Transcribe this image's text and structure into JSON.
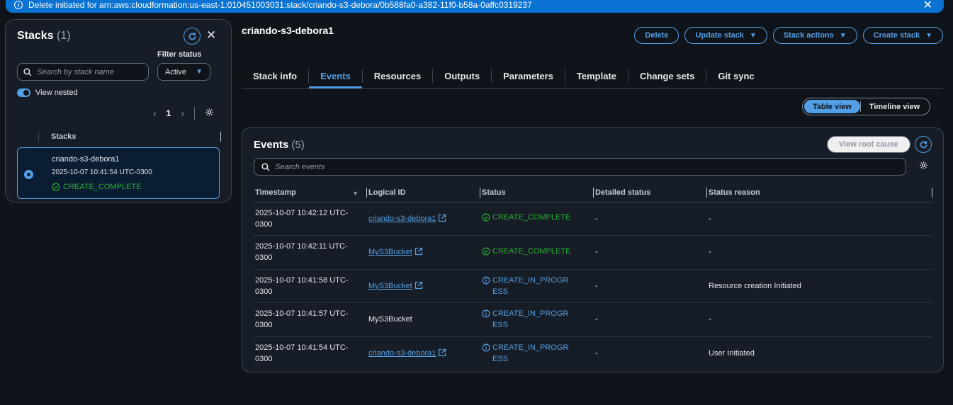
{
  "flash": {
    "message": "Delete initiated for arn:aws:cloudformation:us-east-1:010451003031:stack/criando-s3-debora/0b588fa0-a382-11f0-b58a-0affc0319237"
  },
  "stacks_panel": {
    "title": "Stacks",
    "count": "(1)",
    "filter_label": "Filter status",
    "search_placeholder": "Search by stack name",
    "filter_value": "Active",
    "view_nested_label": "View nested",
    "page": "1",
    "column_header": "Stacks",
    "selected_stack": {
      "name": "criando-s3-debora1",
      "created": "2025-10-07 10:41:54 UTC-0300",
      "status": "CREATE_COMPLETE"
    }
  },
  "stack": {
    "title": "criando-s3-debora1"
  },
  "actions": {
    "delete": "Delete",
    "update": "Update stack",
    "stack_actions": "Stack actions",
    "create": "Create stack"
  },
  "tabs": [
    {
      "label": "Stack info"
    },
    {
      "label": "Events"
    },
    {
      "label": "Resources"
    },
    {
      "label": "Outputs"
    },
    {
      "label": "Parameters"
    },
    {
      "label": "Template"
    },
    {
      "label": "Change sets"
    },
    {
      "label": "Git sync"
    }
  ],
  "view_toggle": {
    "table": "Table view",
    "timeline": "Timeline view"
  },
  "events": {
    "title": "Events",
    "count": "(5)",
    "view_root_cause": "View root cause",
    "search_placeholder": "Search events",
    "columns": [
      "Timestamp",
      "Logical ID",
      "Status",
      "Detailed status",
      "Status reason"
    ],
    "rows": [
      {
        "timestamp": "2025-10-07 10:42:12 UTC-0300",
        "logical_id": "criando-s3-debora1",
        "status": "CREATE_COMPLETE",
        "detailed": "-",
        "reason": "-"
      },
      {
        "timestamp": "2025-10-07 10:42:11 UTC-0300",
        "logical_id": "MyS3Bucket",
        "status": "CREATE_COMPLETE",
        "detailed": "-",
        "reason": "-"
      },
      {
        "timestamp": "2025-10-07 10:41:58 UTC-0300",
        "logical_id": "MyS3Bucket",
        "status": "CREATE_IN_PROGRESS",
        "detailed": "-",
        "reason": "Resource creation Initiated"
      },
      {
        "timestamp": "2025-10-07 10:41:57 UTC-0300",
        "logical_id": "MyS3Bucket",
        "status": "CREATE_IN_PROGRESS",
        "detailed": "-",
        "reason": "-"
      },
      {
        "timestamp": "2025-10-07 10:41:54 UTC-0300",
        "logical_id": "criando-s3-debora1",
        "status": "CREATE_IN_PROGRESS",
        "detailed": "-",
        "reason": "User Initiated"
      }
    ]
  },
  "colors": {
    "accent": "#539fe5",
    "success": "#29ad32",
    "background": "#0f141a",
    "panel": "#161d26",
    "flash": "#0972d3"
  }
}
